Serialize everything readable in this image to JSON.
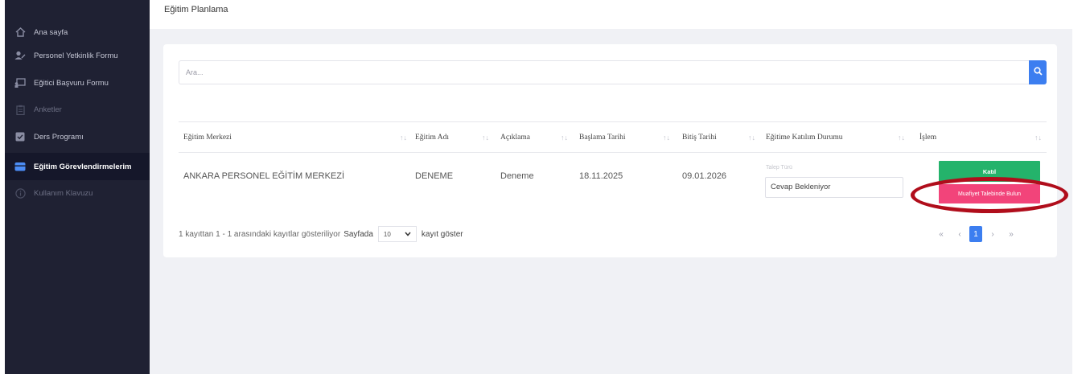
{
  "sidebar": {
    "items": [
      {
        "label": "Ana sayfa",
        "icon": "home-icon"
      },
      {
        "label": "Personel Yetkinlik Formu",
        "icon": "user-edit-icon"
      },
      {
        "label": "Eğitici Başvuru Formu",
        "icon": "presentation-icon"
      },
      {
        "label": "Anketler",
        "icon": "clipboard-icon"
      },
      {
        "label": "Ders Programı",
        "icon": "checkbox-icon"
      },
      {
        "label": "Eğitim Görevlendirmelerim",
        "icon": "calendar-icon"
      },
      {
        "label": "Kullanım Klavuzu",
        "icon": "info-icon"
      }
    ],
    "active_index": 5
  },
  "header": {
    "title": "Eğitim Planlama"
  },
  "search": {
    "placeholder": "Ara..."
  },
  "table": {
    "columns": [
      "Eğitim Merkezi",
      "Eğitim Adı",
      "Açıklama",
      "Başlama Tarihi",
      "Bitiş Tarihi",
      "Eğitime Katılım Durumu",
      "İşlem"
    ],
    "rows": [
      {
        "center": "ANKARA PERSONEL EĞİTİM MERKEZİ",
        "name": "DENEME",
        "description": "Deneme",
        "start": "18.11.2025",
        "end": "09.01.2026",
        "status_label": "Talep Türü",
        "status": "Cevap Bekleniyor",
        "actions": {
          "join": "Katıl",
          "exemption": "Muafiyet Talebinde Bulun"
        }
      }
    ]
  },
  "footer": {
    "summary": "1 kayıttan 1 - 1 arasındaki kayıtlar gösteriliyor",
    "per_page_prefix": "Sayfada",
    "per_page_value": "10",
    "per_page_suffix": "kayıt göster"
  },
  "pagination": {
    "first": "«",
    "prev": "‹",
    "current": "1",
    "next": "›",
    "last": "»"
  },
  "colors": {
    "sidebar_bg": "#1f2133",
    "accent": "#3c7ef0",
    "join_button": "#24b36b",
    "exemption_button": "#f2447a",
    "highlight_ring": "#b00d1b"
  }
}
